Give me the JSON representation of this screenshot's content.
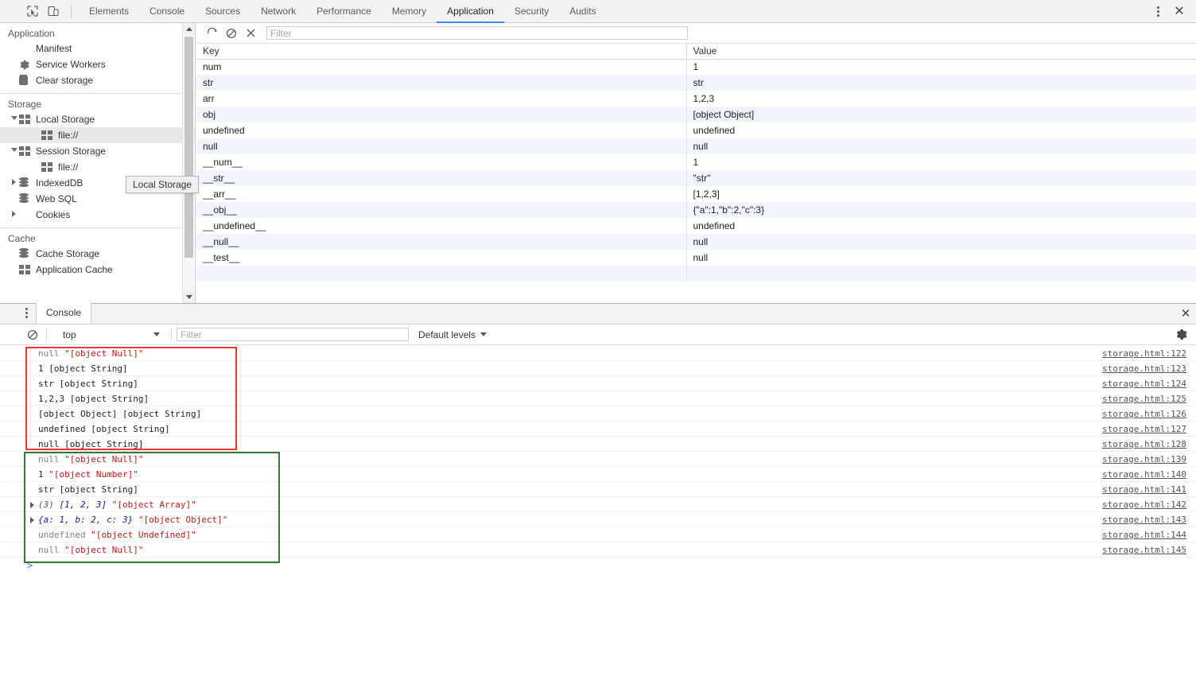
{
  "topbar": {
    "icons": [
      {
        "name": "inspect-element-icon",
        "glyph": "inspect"
      },
      {
        "name": "device-toolbar-icon",
        "glyph": "device"
      }
    ],
    "tabs": [
      {
        "label": "Elements",
        "active": false
      },
      {
        "label": "Console",
        "active": false
      },
      {
        "label": "Sources",
        "active": false
      },
      {
        "label": "Network",
        "active": false
      },
      {
        "label": "Performance",
        "active": false
      },
      {
        "label": "Memory",
        "active": false
      },
      {
        "label": "Application",
        "active": true
      },
      {
        "label": "Security",
        "active": false
      },
      {
        "label": "Audits",
        "active": false
      }
    ],
    "more_label": "⋮",
    "close_label": "✕",
    "accent_color": "#4285f4"
  },
  "sidebar": {
    "sections": [
      {
        "title": "Application",
        "items": [
          {
            "label": "Manifest",
            "icon": "manifest-icon"
          },
          {
            "label": "Service Workers",
            "icon": "service-workers-gear-icon"
          },
          {
            "label": "Clear storage",
            "icon": "clear-storage-trash-icon"
          }
        ]
      },
      {
        "title": "Storage",
        "items": [
          {
            "label": "Local Storage",
            "icon": "local-storage-grid-icon",
            "expander": "down"
          },
          {
            "label": "file://",
            "icon": "origin-grid-icon",
            "selected": true,
            "indent": 2
          },
          {
            "label": "Session Storage",
            "icon": "session-storage-grid-icon",
            "expander": "down"
          },
          {
            "label": "file://",
            "icon": "origin-grid-icon",
            "indent": 2
          },
          {
            "label": "IndexedDB",
            "icon": "indexeddb-icon",
            "expander": "right"
          },
          {
            "label": "Web SQL",
            "icon": "websql-icon"
          },
          {
            "label": "Cookies",
            "icon": "cookies-icon",
            "expander": "right"
          }
        ]
      },
      {
        "title": "Cache",
        "items": [
          {
            "label": "Cache Storage",
            "icon": "cache-storage-icon"
          },
          {
            "label": "Application Cache",
            "icon": "application-cache-grid-icon"
          }
        ]
      }
    ],
    "tooltip": "Local Storage"
  },
  "storage_toolbar": {
    "refresh_label": "⟳",
    "clear_label": "⦸",
    "delete_label": "✕",
    "filter_placeholder": "Filter",
    "filter_value": ""
  },
  "storage_table": {
    "columns": [
      "Key",
      "Value"
    ],
    "rows": [
      {
        "key": "num",
        "value": "1"
      },
      {
        "key": "str",
        "value": "str"
      },
      {
        "key": "arr",
        "value": "1,2,3"
      },
      {
        "key": "obj",
        "value": "[object Object]"
      },
      {
        "key": "undefined",
        "value": "undefined"
      },
      {
        "key": "null",
        "value": "null"
      },
      {
        "key": "__num__",
        "value": "1"
      },
      {
        "key": "__str__",
        "value": "\"str\""
      },
      {
        "key": "__arr__",
        "value": "[1,2,3]"
      },
      {
        "key": "__obj__",
        "value": "{\"a\":1,\"b\":2,\"c\":3}"
      },
      {
        "key": "__undefined__",
        "value": "undefined"
      },
      {
        "key": "__null__",
        "value": "null"
      },
      {
        "key": "__test__",
        "value": "null"
      }
    ]
  },
  "console": {
    "panel_tab": "Console",
    "more_label": "⋮",
    "close_label": "✕",
    "clear_label": "⦸",
    "context": "top",
    "filter_placeholder": "Filter",
    "filter_value": "",
    "levels_label": "Default levels",
    "settings_label": "gear",
    "prompt": ">",
    "messages": [
      {
        "tokens": [
          {
            "text": "null",
            "type": "null"
          },
          {
            "text": " ",
            "type": "plain"
          },
          {
            "text": "\"[object Null]\"",
            "type": "str"
          }
        ],
        "source": "storage.html:122"
      },
      {
        "tokens": [
          {
            "text": "1 [object String]",
            "type": "plain"
          }
        ],
        "source": "storage.html:123"
      },
      {
        "tokens": [
          {
            "text": "str [object String]",
            "type": "plain"
          }
        ],
        "source": "storage.html:124"
      },
      {
        "tokens": [
          {
            "text": "1,2,3 [object String]",
            "type": "plain"
          }
        ],
        "source": "storage.html:125"
      },
      {
        "tokens": [
          {
            "text": "[object Object] [object String]",
            "type": "plain"
          }
        ],
        "source": "storage.html:126"
      },
      {
        "tokens": [
          {
            "text": "undefined [object String]",
            "type": "plain"
          }
        ],
        "source": "storage.html:127"
      },
      {
        "tokens": [
          {
            "text": "null [object String]",
            "type": "plain"
          }
        ],
        "source": "storage.html:128"
      },
      {
        "tokens": [
          {
            "text": "null",
            "type": "null"
          },
          {
            "text": " ",
            "type": "plain"
          },
          {
            "text": "\"[object Null]\"",
            "type": "str"
          }
        ],
        "source": "storage.html:139"
      },
      {
        "tokens": [
          {
            "text": "1",
            "type": "num"
          },
          {
            "text": " ",
            "type": "plain"
          },
          {
            "text": "\"[object Number]\"",
            "type": "str"
          }
        ],
        "source": "storage.html:140"
      },
      {
        "tokens": [
          {
            "text": "str [object String]",
            "type": "plain"
          }
        ],
        "source": "storage.html:141"
      },
      {
        "expander": true,
        "tokens": [
          {
            "text": "(3) ",
            "type": "objgray"
          },
          {
            "text": "[1, 2, 3]",
            "type": "obj"
          },
          {
            "text": " ",
            "type": "plain"
          },
          {
            "text": "\"[object Array]\"",
            "type": "str"
          }
        ],
        "source": "storage.html:142"
      },
      {
        "expander": true,
        "tokens": [
          {
            "text": "{a: 1, b: 2, c: 3}",
            "type": "obj"
          },
          {
            "text": " ",
            "type": "plain"
          },
          {
            "text": "\"[object Object]\"",
            "type": "str"
          }
        ],
        "source": "storage.html:143"
      },
      {
        "tokens": [
          {
            "text": "undefined",
            "type": "undef"
          },
          {
            "text": " ",
            "type": "plain"
          },
          {
            "text": "\"[object Undefined]\"",
            "type": "str"
          }
        ],
        "source": "storage.html:144"
      },
      {
        "tokens": [
          {
            "text": "null",
            "type": "null"
          },
          {
            "text": " ",
            "type": "plain"
          },
          {
            "text": "\"[object Null]\"",
            "type": "str"
          }
        ],
        "source": "storage.html:145"
      }
    ],
    "annotations": [
      {
        "name": "red-highlight-box",
        "color": "#e53935"
      },
      {
        "name": "green-highlight-box",
        "color": "#2e7d32"
      }
    ]
  }
}
